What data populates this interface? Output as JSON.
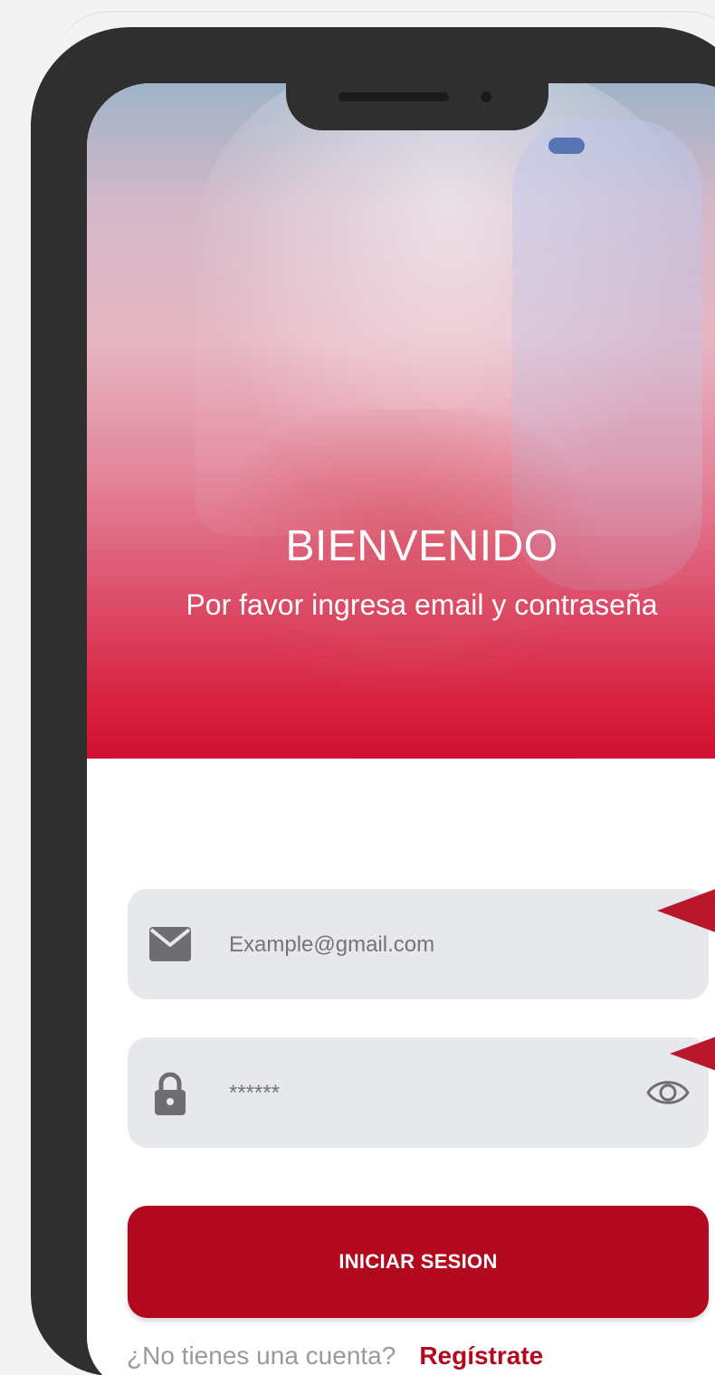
{
  "hero": {
    "title": "BIENVENIDO",
    "subtitle": "Por favor ingresa email y contraseña"
  },
  "form": {
    "email": {
      "icon": "envelope-icon",
      "placeholder": "Example@gmail.com",
      "value": ""
    },
    "password": {
      "icon": "lock-icon",
      "placeholder": "******",
      "value": "",
      "toggle_icon": "eye-icon"
    },
    "submit_label": "INICIAR SESION"
  },
  "signup": {
    "question": "¿No tienes una cuenta?",
    "link_label": "Regístrate"
  },
  "colors": {
    "brand": "#b3091f",
    "field_bg": "#e7e8ec",
    "phone_frame": "#2f2f2f",
    "pointer": "#b9172b"
  }
}
